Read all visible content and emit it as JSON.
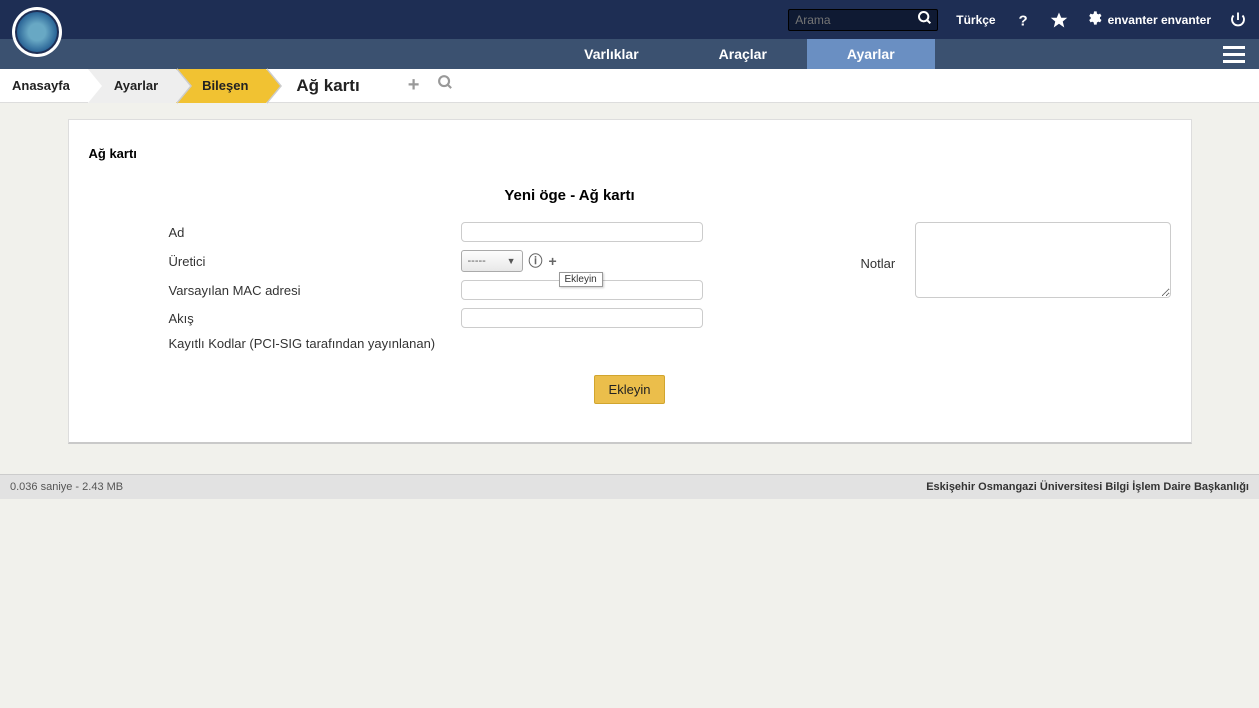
{
  "topbar": {
    "search_placeholder": "Arama",
    "language": "Türkçe",
    "user_name": "envanter envanter"
  },
  "nav": {
    "items": [
      {
        "label": "Varlıklar"
      },
      {
        "label": "Araçlar"
      },
      {
        "label": "Ayarlar"
      }
    ]
  },
  "breadcrumb": {
    "items": [
      {
        "label": "Anasayfa"
      },
      {
        "label": "Ayarlar"
      },
      {
        "label": "Bileşen"
      }
    ],
    "current": "Ağ kartı"
  },
  "panel": {
    "heading": "Ağ kartı",
    "form_title": "Yeni öge - Ağ kartı",
    "fields": {
      "name_label": "Ad",
      "manufacturer_label": "Üretici",
      "manufacturer_value": "-----",
      "mac_label": "Varsayılan MAC adresi",
      "flow_label": "Akış",
      "codes_label": "Kayıtlı Kodlar (PCI-SIG tarafından yayınlanan)",
      "notes_label": "Notlar"
    },
    "tooltip": "Ekleyin",
    "submit_label": "Ekleyin"
  },
  "footer": {
    "perf": "0.036 saniye - 2.43 MB",
    "org": "Eskişehir Osmangazi Üniversitesi Bilgi İşlem Daire Başkanlığı"
  }
}
